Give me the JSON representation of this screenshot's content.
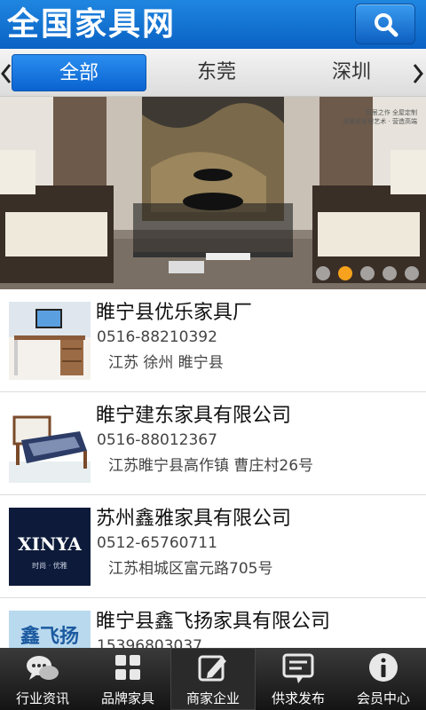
{
  "header": {
    "title": "全国家具网",
    "search_icon": "search-icon"
  },
  "tabs": [
    {
      "label": "全部",
      "active": true
    },
    {
      "label": "东莞",
      "active": false
    },
    {
      "label": "深圳",
      "active": false
    }
  ],
  "banner": {
    "watermark_lines": [
      "佰居之作  全屋定制",
      "美奥美家居艺术 · 营造高端"
    ],
    "slide_count": 5,
    "active_slide": 2
  },
  "companies": [
    {
      "name": "睢宁县优乐家具厂",
      "phone": "0516-88210392",
      "address": "江苏 徐州 睢宁县",
      "thumb": "desk-thumbnail"
    },
    {
      "name": "睢宁建东家具有限公司",
      "phone": "0516-88012367",
      "address": "江苏睢宁县高作镇 曹庄村26号",
      "thumb": "bed-thumbnail"
    },
    {
      "name": "苏州鑫雅家具有限公司",
      "phone": "0512-65760711",
      "address": "江苏相城区富元路705号",
      "thumb": "xinya-logo",
      "logo_text": "XINYA",
      "logo_sub": "时尚 · 优雅"
    },
    {
      "name": "睢宁县鑫飞扬家具有限公司",
      "phone": "15396803037",
      "address": "",
      "thumb": "xinfeiyang-logo",
      "logo_text": "鑫飞扬"
    }
  ],
  "bottom_nav": [
    {
      "label": "行业资讯",
      "icon": "chat-bubbles-icon",
      "active": false
    },
    {
      "label": "品牌家具",
      "icon": "grid-icon",
      "active": false
    },
    {
      "label": "商家企业",
      "icon": "edit-icon",
      "active": true
    },
    {
      "label": "供求发布",
      "icon": "message-icon",
      "active": false
    },
    {
      "label": "会员中心",
      "icon": "info-icon",
      "active": false
    }
  ],
  "colors": {
    "header_blue": "#0a62c4",
    "tab_active": "#1a78e0",
    "dot_active": "#f7a21c",
    "nav_bg": "#1e1e1e"
  }
}
